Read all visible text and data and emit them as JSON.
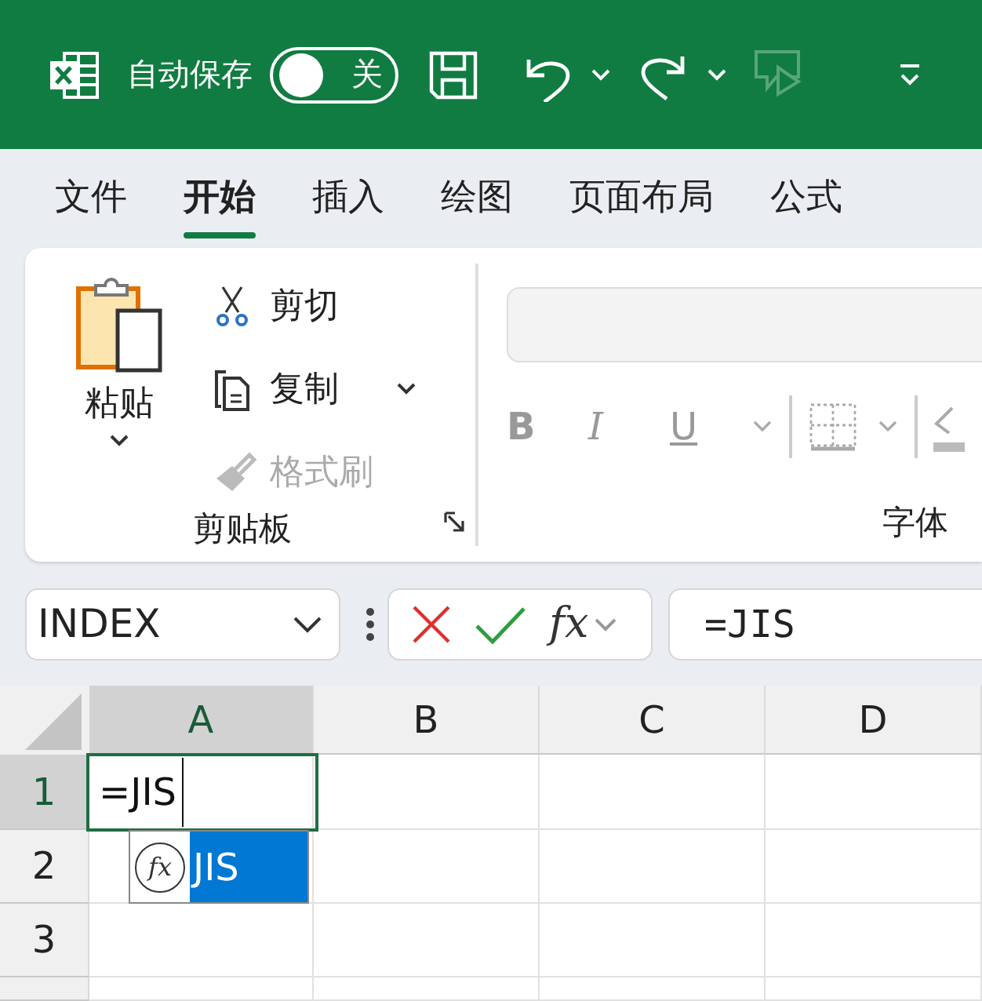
{
  "title_bar": {
    "autosave_label": "自动保存",
    "autosave_toggle": {
      "on": false,
      "label": "关"
    }
  },
  "tabs": [
    {
      "label": "文件",
      "selected": false
    },
    {
      "label": "开始",
      "selected": true
    },
    {
      "label": "插入",
      "selected": false
    },
    {
      "label": "绘图",
      "selected": false
    },
    {
      "label": "页面布局",
      "selected": false
    },
    {
      "label": "公式",
      "selected": false
    }
  ],
  "ribbon": {
    "clipboard": {
      "name": "剪贴板",
      "paste": "粘贴",
      "items": [
        {
          "kind": "cut",
          "label": "剪切",
          "disabled": false,
          "dropdown": false
        },
        {
          "kind": "copy",
          "label": "复制",
          "disabled": false,
          "dropdown": true
        },
        {
          "kind": "format_painter",
          "label": "格式刷",
          "disabled": true,
          "dropdown": false
        }
      ]
    },
    "font": {
      "name": "字体",
      "disabled": true,
      "buttons": [
        {
          "kind": "bold",
          "label": "B"
        },
        {
          "kind": "italic",
          "label": "I"
        },
        {
          "kind": "underline",
          "label": "U"
        }
      ]
    }
  },
  "formula_bar": {
    "name_box": "INDEX",
    "function_button": "fx",
    "formula": "=JIS"
  },
  "sheet": {
    "columns": [
      {
        "label": "A",
        "selected": true
      },
      {
        "label": "B",
        "selected": false
      },
      {
        "label": "C",
        "selected": false
      },
      {
        "label": "D",
        "selected": false
      }
    ],
    "rows": [
      {
        "label": "1",
        "selected": true
      },
      {
        "label": "2",
        "selected": false
      },
      {
        "label": "3",
        "selected": false
      }
    ],
    "editing_text": "=JIS",
    "autocomplete": [
      {
        "icon_text": "fx",
        "label": "JIS",
        "selected": true
      }
    ]
  }
}
